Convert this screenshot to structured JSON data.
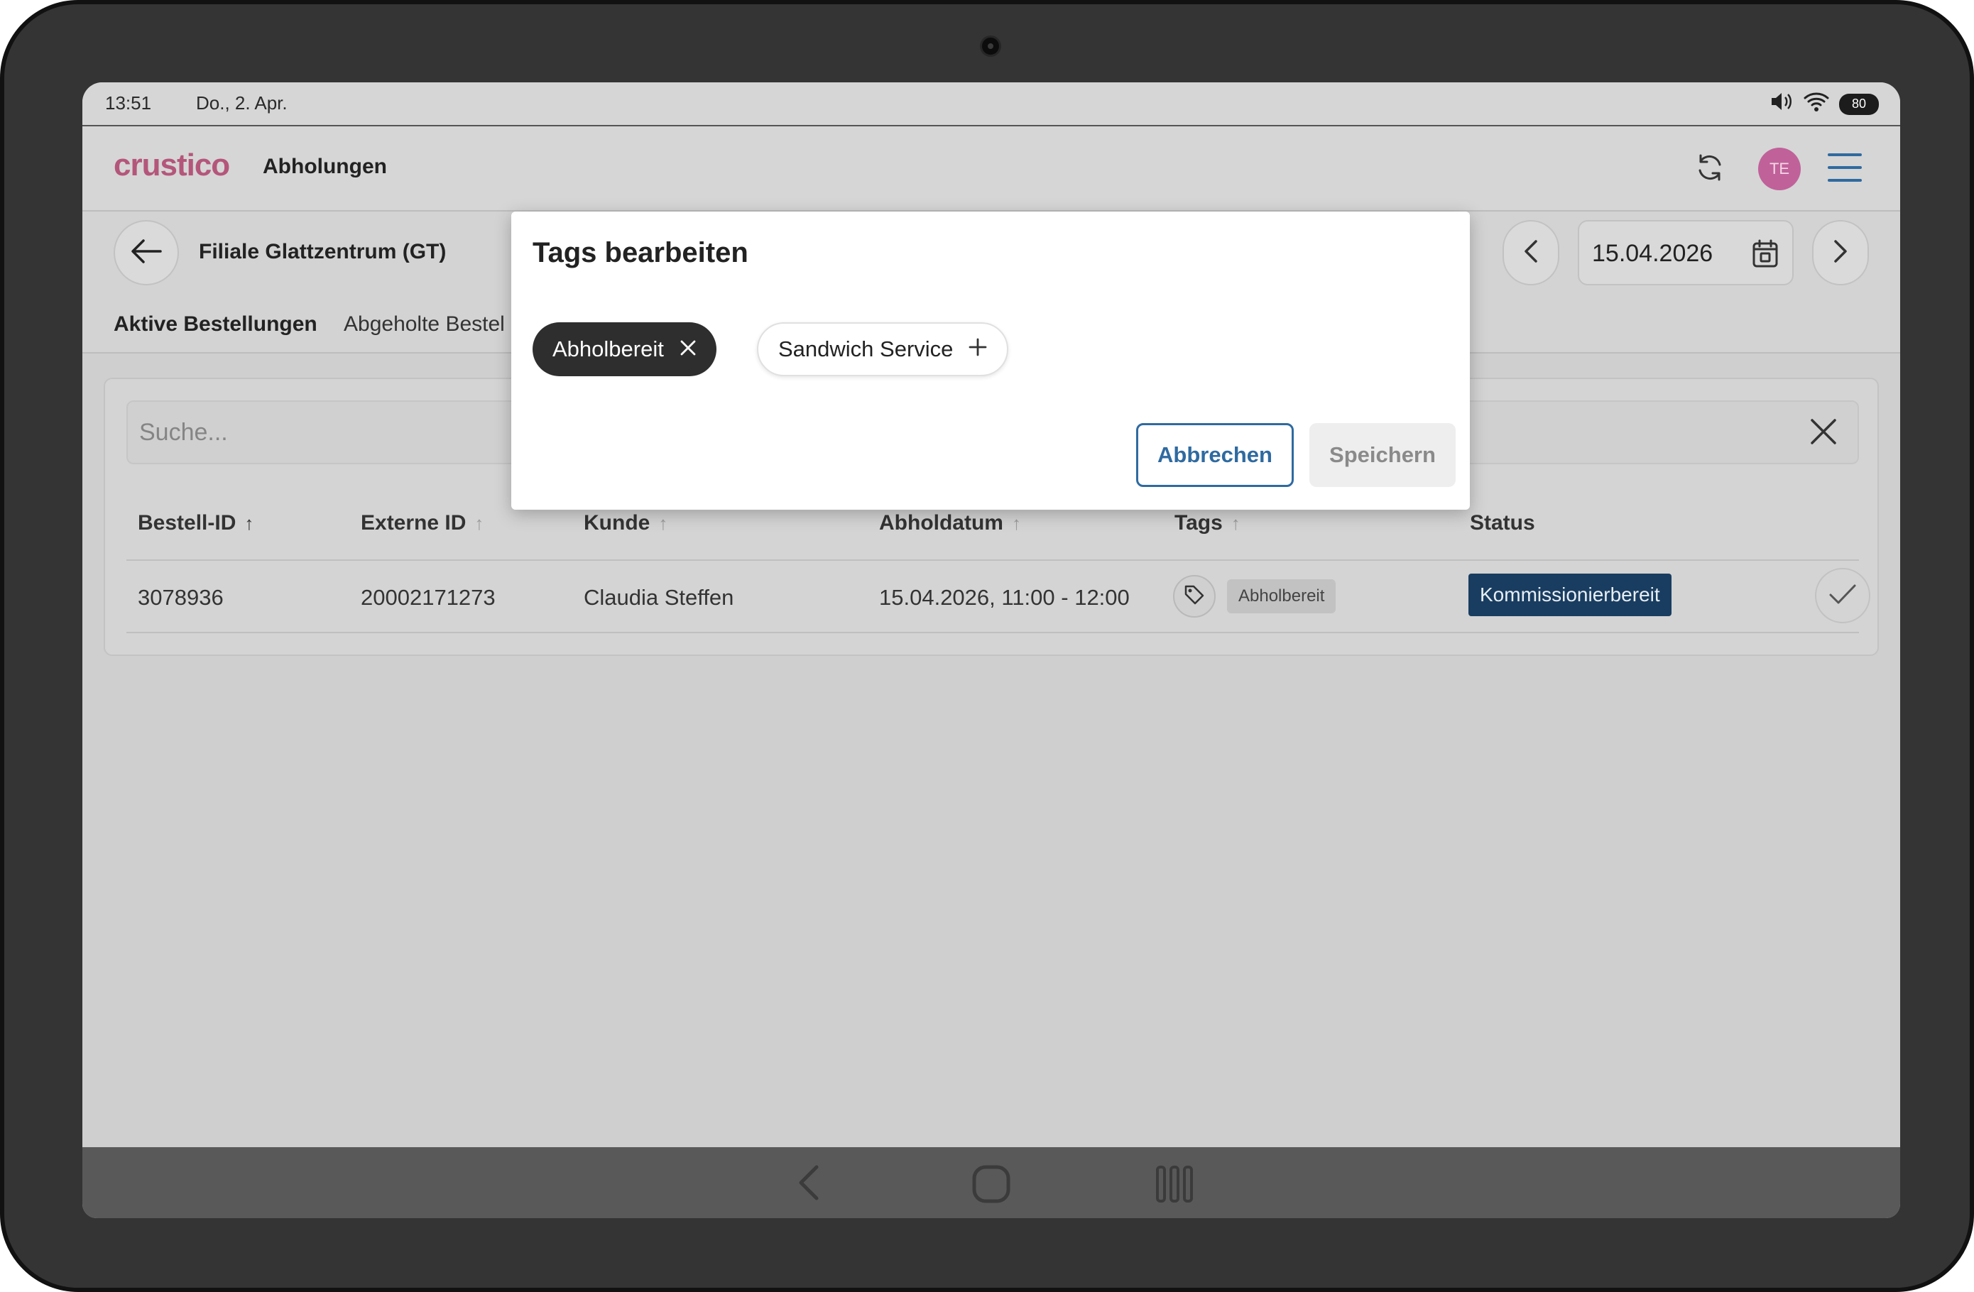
{
  "status_bar": {
    "time": "13:51",
    "date": "Do., 2. Apr.",
    "battery": "80"
  },
  "app": {
    "logo": "crustico",
    "title": "Abholungen",
    "avatar_initials": "TE"
  },
  "toolbar": {
    "branch": "Filiale Glattzentrum (GT)",
    "tabs": [
      "Aktive Bestellungen",
      "Abgeholte Bestel"
    ],
    "date": "15.04.2026"
  },
  "search": {
    "placeholder": "Suche..."
  },
  "table": {
    "columns": [
      "Bestell-ID",
      "Externe ID",
      "Kunde",
      "Abholdatum",
      "Tags",
      "Status"
    ],
    "rows": [
      {
        "order_id": "3078936",
        "external_id": "20002171273",
        "customer": "Claudia Steffen",
        "pickup": "15.04.2026, 11:00 - 12:00",
        "tag": "Abholbereit",
        "status": "Kommissionierbereit"
      }
    ]
  },
  "dialog": {
    "title": "Tags bearbeiten",
    "chips": [
      {
        "label": "Abholbereit",
        "selected": true
      },
      {
        "label": "Sandwich Service",
        "selected": false
      }
    ],
    "cancel_label": "Abbrechen",
    "save_label": "Speichern"
  },
  "colors": {
    "brand": "#b4567a",
    "status_badge": "#193d60",
    "cancel_accent": "#2f6aa0",
    "selected_chip": "#2e2e2e"
  },
  "icons": [
    "volume-icon",
    "wifi-icon",
    "refresh-icon",
    "menu-icon",
    "arrow-left-icon",
    "chevron-left-icon",
    "chevron-right-icon",
    "calendar-icon",
    "close-icon",
    "tag-icon",
    "check-icon",
    "plus-icon"
  ]
}
